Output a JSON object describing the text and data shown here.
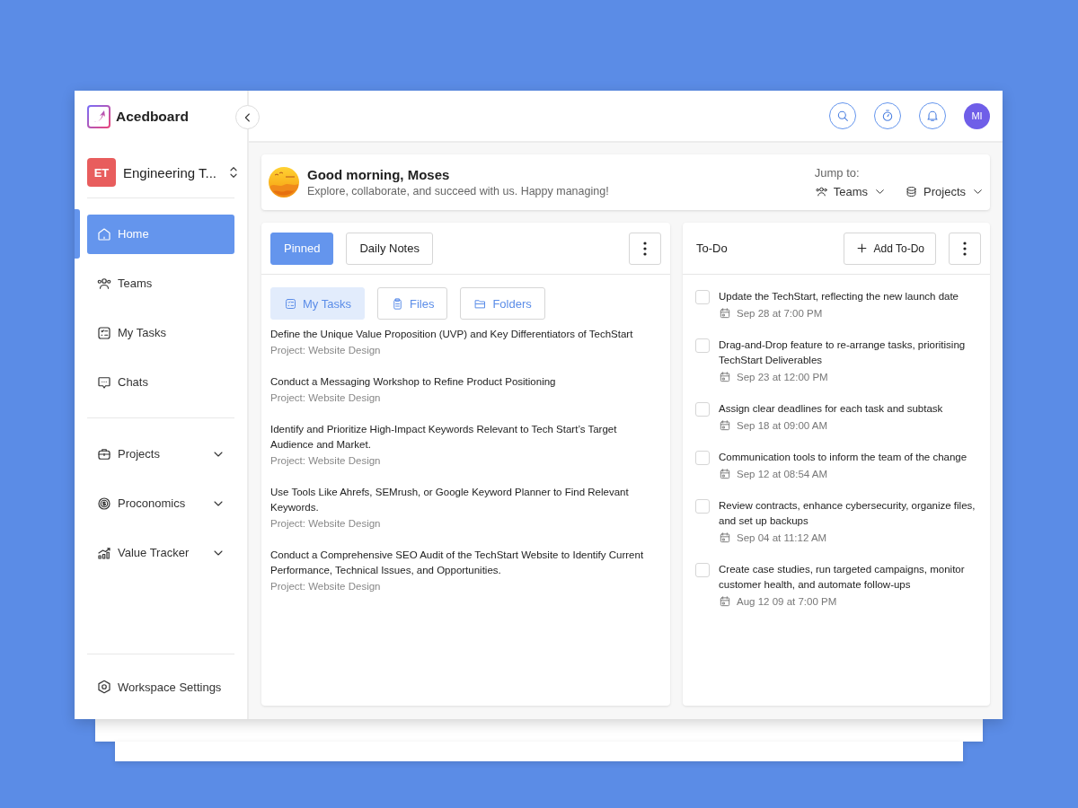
{
  "app": {
    "name": "Acedboard"
  },
  "workspace": {
    "initials": "ET",
    "name": "Engineering T..."
  },
  "sidebar": {
    "groups": [
      {
        "items": [
          {
            "label": "Home",
            "selected": true,
            "expandable": false
          },
          {
            "label": "Teams",
            "selected": false,
            "expandable": false
          },
          {
            "label": "My Tasks",
            "selected": false,
            "expandable": false
          },
          {
            "label": "Chats",
            "selected": false,
            "expandable": false
          }
        ]
      },
      {
        "items": [
          {
            "label": "Projects",
            "selected": false,
            "expandable": true
          },
          {
            "label": "Proconomics",
            "selected": false,
            "expandable": true
          },
          {
            "label": "Value Tracker",
            "selected": false,
            "expandable": true
          }
        ]
      }
    ],
    "footer_item": {
      "label": "Workspace Settings"
    }
  },
  "topbar": {
    "avatar": "MI"
  },
  "greeting": {
    "title": "Good morning, Moses",
    "subtitle": "Explore, collaborate, and succeed with us. Happy managing!",
    "jump_label": "Jump to:",
    "jump_links": [
      {
        "label": "Teams"
      },
      {
        "label": "Projects"
      }
    ]
  },
  "pinned_panel": {
    "tabs": [
      {
        "label": "Pinned",
        "selected": true
      },
      {
        "label": "Daily Notes",
        "selected": false
      }
    ],
    "filters": [
      {
        "label": "My Tasks",
        "selected": true
      },
      {
        "label": "Files",
        "selected": false
      },
      {
        "label": "Folders",
        "selected": false
      }
    ],
    "tasks": [
      {
        "title": "Define the Unique Value Proposition (UVP) and Key Differentiators of TechStart",
        "project": "Project: Website Design"
      },
      {
        "title": "Conduct a Messaging Workshop to Refine Product Positioning",
        "project": "Project: Website Design"
      },
      {
        "title": "Identify and Prioritize High-Impact Keywords Relevant to Tech Start’s Target Audience and Market.",
        "project": "Project: Website Design"
      },
      {
        "title": "Use Tools Like Ahrefs, SEMrush, or Google Keyword Planner to Find Relevant Keywords.",
        "project": "Project: Website Design"
      },
      {
        "title": "Conduct a Comprehensive SEO Audit of the TechStart Website to Identify Current Performance, Technical Issues, and Opportunities.",
        "project": "Project: Website Design"
      }
    ]
  },
  "todo": {
    "title": "To-Do",
    "add_button": "Add To-Do",
    "items": [
      {
        "text": "Update the TechStart, reflecting the new launch date",
        "due": "Sep 28 at 7:00 PM",
        "checked": false
      },
      {
        "text": "Drag-and-Drop feature to re-arrange tasks, prioritising TechStart Deliverables",
        "due": "Sep 23 at 12:00 PM",
        "checked": false
      },
      {
        "text": "Assign clear deadlines for each task and subtask",
        "due": "Sep 18 at 09:00 AM",
        "checked": false
      },
      {
        "text": "Communication tools to inform the team of the change",
        "due": "Sep 12 at 08:54 AM",
        "checked": false
      },
      {
        "text": "Review contracts, enhance cybersecurity, organize files, and set up backups",
        "due": "Sep 04 at 11:12 AM",
        "checked": false
      },
      {
        "text": "Create case studies, run targeted campaigns, monitor customer health, and automate follow-ups",
        "due": "Aug 12 09 at 7:00 PM",
        "checked": false
      }
    ]
  }
}
